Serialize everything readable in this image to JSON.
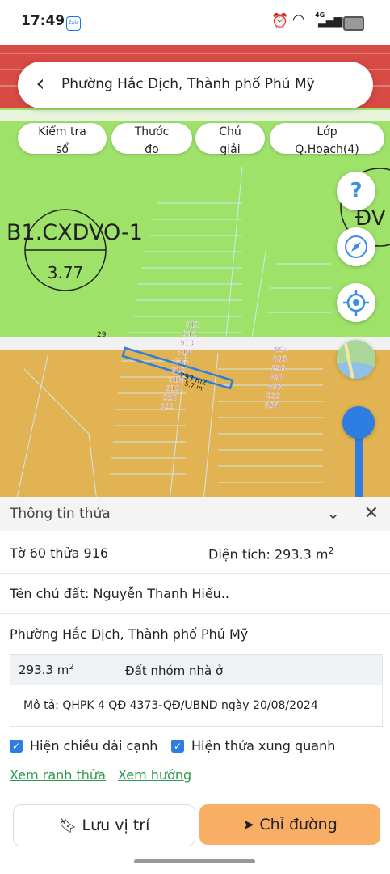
{
  "status_bar": {
    "time": "17:49",
    "zalo": "Zalo",
    "network": "4G"
  },
  "header": {
    "title": "Phường Hắc Dịch, Thành phố Phú Mỹ"
  },
  "chips": [
    {
      "line1": "Kiểm tra",
      "line2": "sổ"
    },
    {
      "line1": "Thước",
      "line2": "đo"
    },
    {
      "line1": "Chú",
      "line2": "giải"
    },
    {
      "line1": "Lớp",
      "line2": "Q.Hoạch(4)"
    }
  ],
  "map": {
    "zone_code": "B1.CXDVO-1",
    "zone_value": "3.77",
    "zone_code_right": "ĐV",
    "parcel_left_column": [
      "911",
      "912",
      "913",
      "914",
      "915",
      "917",
      "918",
      "919",
      "920",
      "921"
    ],
    "parcel_right_column": [
      "894",
      "895",
      "896",
      "897",
      "898",
      "899",
      "854"
    ],
    "parcel_29": "29",
    "area_label": "293 m2",
    "dim_label": "5.7 m",
    "colors": {
      "top_zone": "#d84a44",
      "green_zone": "#9ee26a",
      "orange_zone": "#e2b352",
      "road": "#f1f1f1",
      "highlight": "#2e7de0"
    }
  },
  "fabs": {
    "help": "?",
    "compass": "compass-icon",
    "locate": "locate-icon",
    "layers": "layers-icon"
  },
  "sheet": {
    "title": "Thông tin thửa",
    "sheet_parcel": "Tờ 60 thửa 916",
    "area_label": "Diện tích: 293.3 m",
    "area_sup": "2",
    "owner": "Tên chủ đất: Nguyễn Thanh Hiếu..",
    "address": "Phường Hắc Dịch, Thành phố Phú Mỹ",
    "box_area": "293.3 m",
    "box_area_sup": "2",
    "land_type": "Đất nhóm nhà ở",
    "description": "Mô tả: QHPK 4 QĐ 4373-QĐ/UBND ngày 20/08/2024",
    "check_edge": "Hiện chiều dài cạnh",
    "check_neighbors": "Hiện thửa xung quanh",
    "link_boundary": "Xem ranh thửa",
    "link_direction": "Xem hướng",
    "save_label": "Lưu vị trí",
    "direction_label": "Chỉ đường"
  }
}
